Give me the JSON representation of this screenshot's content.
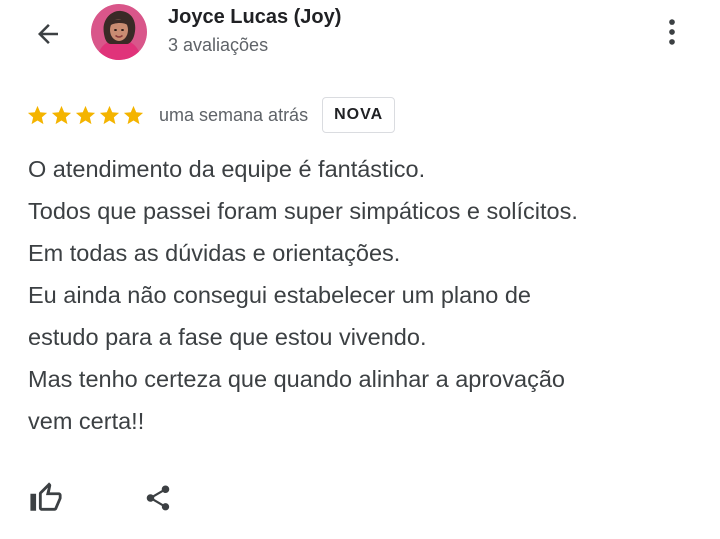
{
  "header": {
    "back_icon": "arrow-left-icon",
    "reviewer_name": "Joyce Lucas (Joy)",
    "review_count": "3 avaliações",
    "more_icon": "more-vert-icon"
  },
  "review": {
    "rating": 5,
    "rating_max": 5,
    "star_color": "#f4b400",
    "time_ago": "uma semana atrás",
    "badge": "NOVA",
    "lines": [
      "O atendimento da equipe é fantástico.",
      "Todos que passei foram super simpáticos e solícitos.",
      "Em todas as dúvidas e orientações.",
      "Eu ainda não consegui estabelecer um plano de",
      "estudo para a fase que estou vivendo.",
      "Mas tenho certeza que quando alinhar a aprovação",
      "vem certa!!"
    ]
  },
  "actions": {
    "like_icon": "thumbs-up-icon",
    "share_icon": "share-icon"
  }
}
